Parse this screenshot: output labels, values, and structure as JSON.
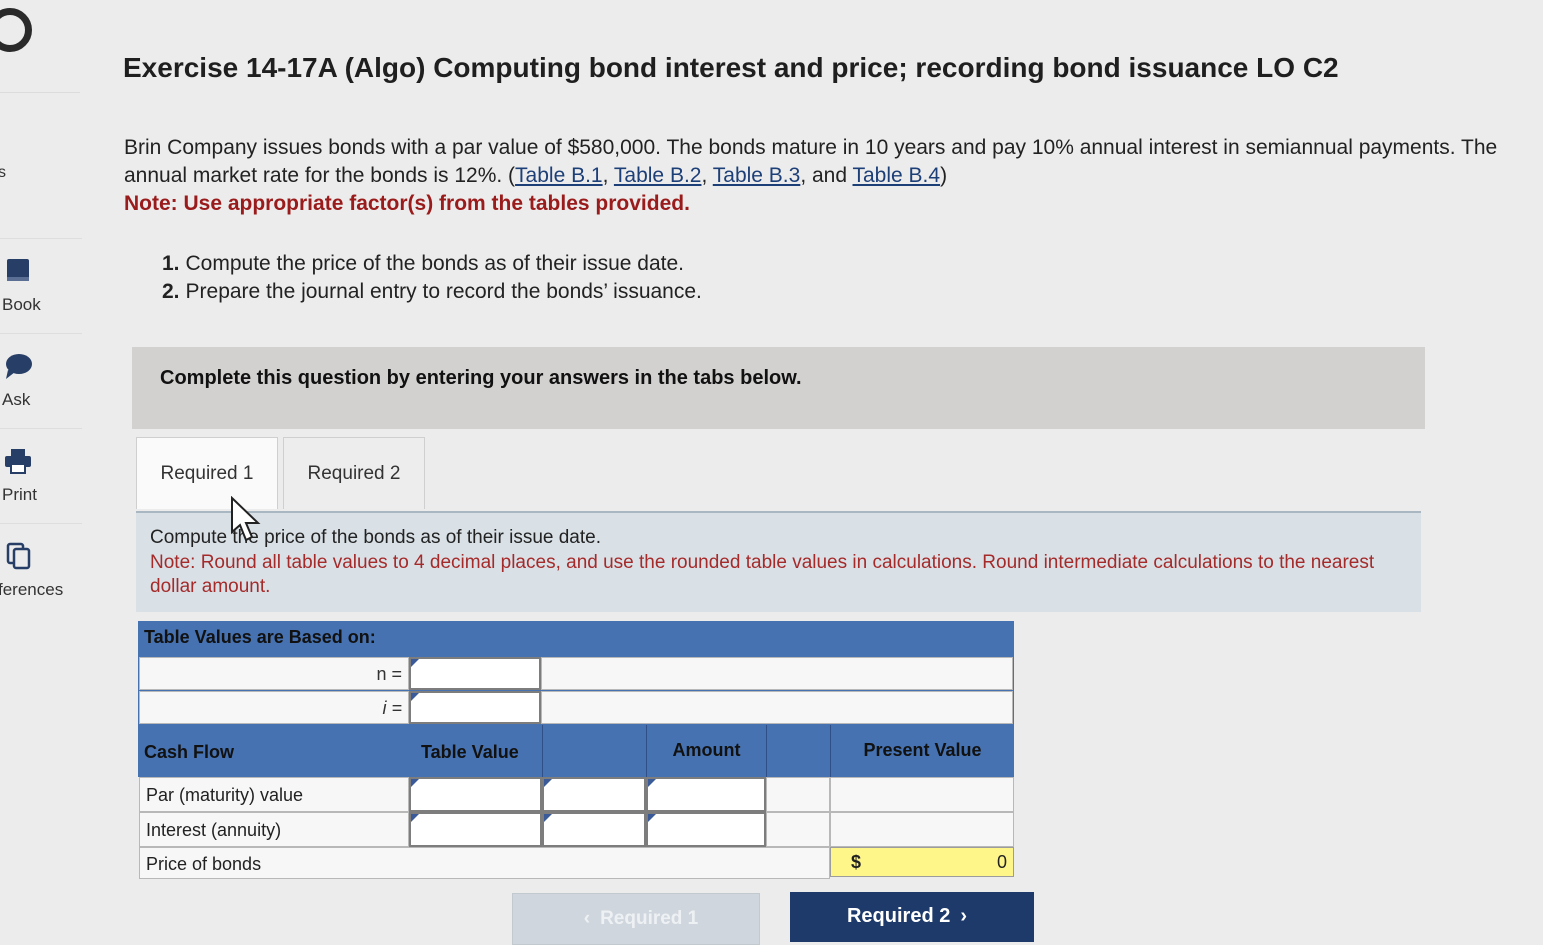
{
  "sidebar": {
    "fragment": "s",
    "items": [
      {
        "label": "Book",
        "icon": "book-icon"
      },
      {
        "label": "Ask",
        "icon": "chat-bubble-icon"
      },
      {
        "label": "Print",
        "icon": "printer-icon"
      },
      {
        "label": "ferences",
        "icon": "copy-icon"
      }
    ]
  },
  "exercise": {
    "title": "Exercise 14-17A (Algo) Computing bond interest and price; recording bond issuance LO C2",
    "desc_part1": "Brin Company issues bonds with a par value of $580,000. The bonds mature in 10 years and pay 10% annual interest in semiannual payments. The annual market rate for the bonds is 12%. (",
    "links": [
      "Table B.1",
      "Table B.2",
      "Table B.3",
      "Table B.4"
    ],
    "sep1": ", ",
    "sep2": ", ",
    "sep3": ", and ",
    "desc_close": ")",
    "note": "Note: Use appropriate factor(s) from the tables provided.",
    "requirements": [
      {
        "num": "1.",
        "text": "Compute the price of the bonds as of their issue date."
      },
      {
        "num": "2.",
        "text": "Prepare the journal entry to record the bonds’ issuance."
      }
    ]
  },
  "instruction": "Complete this question by entering your answers in the tabs below.",
  "tabs": [
    {
      "label": "Required 1",
      "active": true
    },
    {
      "label": "Required 2",
      "active": false
    }
  ],
  "task": {
    "line1": "Compute the price of the bonds as of their issue date.",
    "note": "Note: Round all table values to 4 decimal places, and use the rounded table values in calculations. Round intermediate calculations to the nearest dollar amount."
  },
  "table": {
    "header": "Table Values are Based on:",
    "n_label": "n =",
    "i_label": "i =",
    "columns": [
      "Cash Flow",
      "Table Value",
      "Amount",
      "Present Value"
    ],
    "rows": [
      "Par (maturity) value",
      "Interest (annuity)",
      "Price of bonds"
    ],
    "price_currency": "$",
    "price_value": "0"
  },
  "buttons": {
    "prev_label": "Required 1",
    "next_label": "Required 2"
  },
  "colors": {
    "header_blue": "#4672b1",
    "note_red": "#a52a2a",
    "nav_dark": "#1e3a6b",
    "total_yellow": "#fff68a"
  }
}
